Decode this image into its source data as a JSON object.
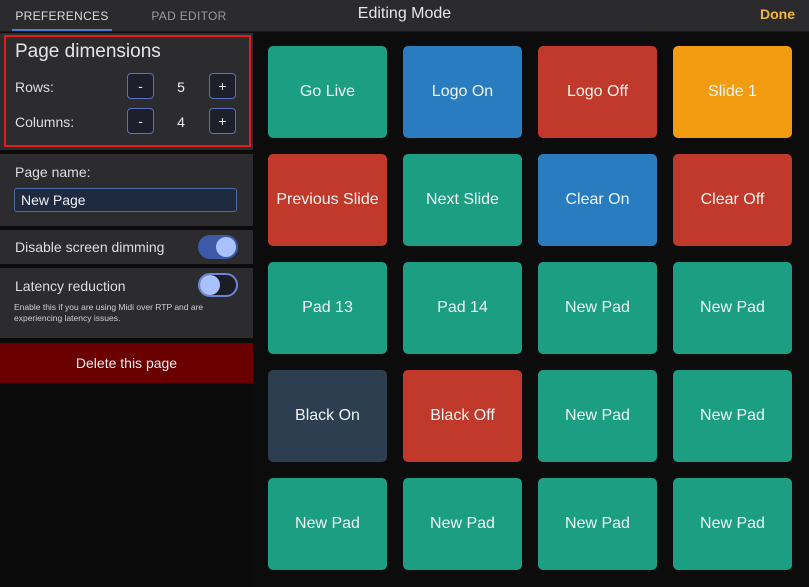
{
  "tabs": [
    {
      "label": "PREFERENCES"
    },
    {
      "label": "PAD EDITOR"
    }
  ],
  "header": {
    "title": "Editing Mode",
    "done_label": "Done"
  },
  "dimensions": {
    "title": "Page dimensions",
    "rows": {
      "label": "Rows:",
      "value": "5",
      "minus": "-",
      "plus": "+"
    },
    "columns": {
      "label": "Columns:",
      "value": "4",
      "minus": "-",
      "plus": "+"
    }
  },
  "page_name": {
    "label": "Page name:",
    "value": "New Page"
  },
  "screen_dimming": {
    "label": "Disable screen dimming",
    "on": true
  },
  "latency": {
    "label": "Latency reduction",
    "description": "Enable this if you are using Midi over RTP and are experiencing latency issues.",
    "on": false
  },
  "delete_label": "Delete this page",
  "colors": {
    "green": "#1c9e83",
    "blue": "#2a7cc0",
    "red": "#c0392b",
    "orange": "#f39c12",
    "navy": "#2c3e50",
    "accent": "#f0b83e"
  },
  "pads": [
    {
      "label": "Go Live",
      "color": "green"
    },
    {
      "label": "Logo On",
      "color": "blue"
    },
    {
      "label": "Logo Off",
      "color": "red"
    },
    {
      "label": "Slide 1",
      "color": "orange"
    },
    {
      "label": "Previous Slide",
      "color": "red"
    },
    {
      "label": "Next Slide",
      "color": "green"
    },
    {
      "label": "Clear On",
      "color": "blue"
    },
    {
      "label": "Clear Off",
      "color": "red"
    },
    {
      "label": "Pad 13",
      "color": "green"
    },
    {
      "label": "Pad 14",
      "color": "green"
    },
    {
      "label": "New Pad",
      "color": "green"
    },
    {
      "label": "New Pad",
      "color": "green"
    },
    {
      "label": "Black On",
      "color": "navy"
    },
    {
      "label": "Black Off",
      "color": "red"
    },
    {
      "label": "New Pad",
      "color": "green"
    },
    {
      "label": "New Pad",
      "color": "green"
    },
    {
      "label": "New Pad",
      "color": "green"
    },
    {
      "label": "New Pad",
      "color": "green"
    },
    {
      "label": "New Pad",
      "color": "green"
    },
    {
      "label": "New Pad",
      "color": "green"
    }
  ]
}
